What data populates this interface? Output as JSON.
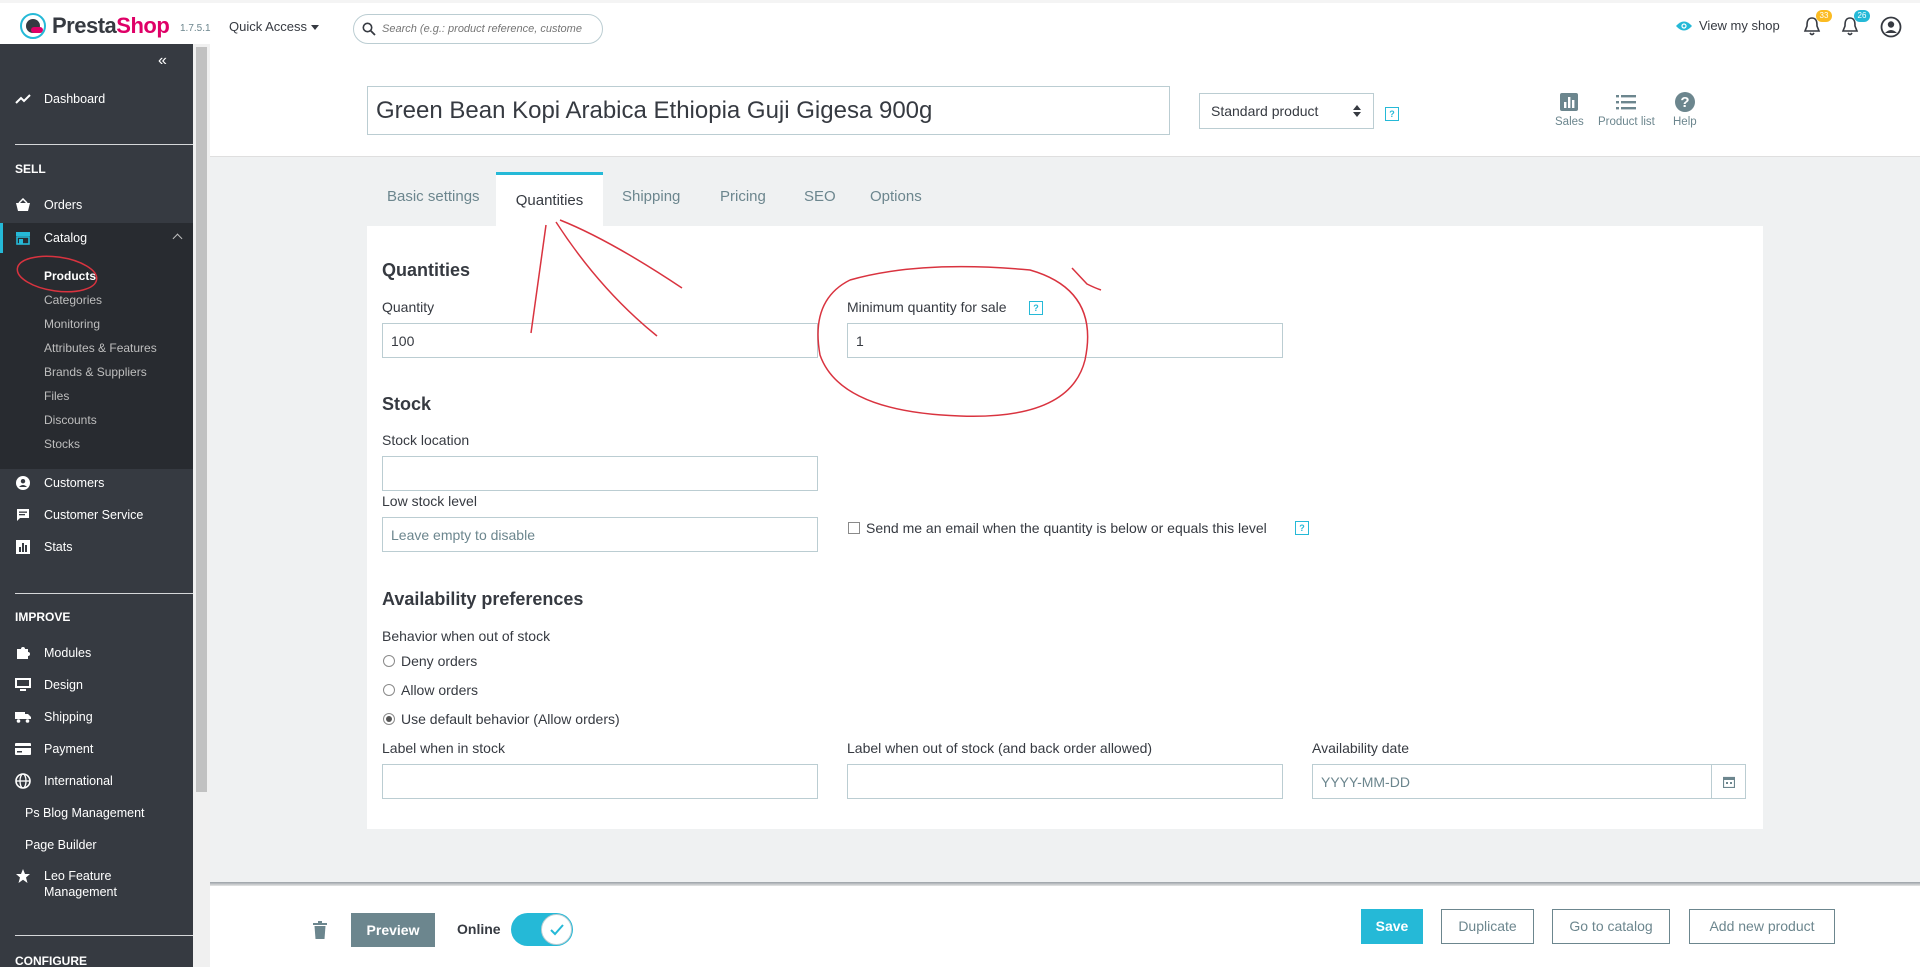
{
  "header": {
    "logo_text_presta": "Presta",
    "logo_text_shop": "Shop",
    "version": "1.7.5.1",
    "quick_access": "Quick Access",
    "search_placeholder": "Search (e.g.: product reference, custome",
    "view_shop": "View my shop",
    "notif_orders_count": "33",
    "notif_customers_count": "26"
  },
  "sidebar": {
    "dashboard": "Dashboard",
    "sell": "SELL",
    "orders": "Orders",
    "catalog": "Catalog",
    "catalog_sub": [
      "Products",
      "Categories",
      "Monitoring",
      "Attributes & Features",
      "Brands & Suppliers",
      "Files",
      "Discounts",
      "Stocks"
    ],
    "customers": "Customers",
    "customer_service": "Customer Service",
    "stats": "Stats",
    "improve": "IMPROVE",
    "modules": "Modules",
    "design": "Design",
    "shipping": "Shipping",
    "payment": "Payment",
    "international": "International",
    "ps_blog": "Ps Blog Management",
    "page_builder": "Page Builder",
    "leo_line1": "Leo Feature",
    "leo_line2": "Management",
    "configure": "CONFIGURE"
  },
  "product": {
    "name": "Green Bean Kopi Arabica Ethiopia Guji Gigesa 900g",
    "type": "Standard product"
  },
  "toolbar": {
    "sales": "Sales",
    "product_list": "Product list",
    "help": "Help"
  },
  "tabs": [
    "Basic settings",
    "Quantities",
    "Shipping",
    "Pricing",
    "SEO",
    "Options"
  ],
  "quantities": {
    "title": "Quantities",
    "quantity_label": "Quantity",
    "quantity_value": "100",
    "min_qty_label": "Minimum quantity for sale",
    "min_qty_value": "1"
  },
  "stock": {
    "title": "Stock",
    "location_label": "Stock location",
    "location_value": "",
    "low_level_label": "Low stock level",
    "low_level_placeholder": "Leave empty to disable",
    "email_checkbox": "Send me an email when the quantity is below or equals this level"
  },
  "availability": {
    "title": "Availability preferences",
    "behavior_label": "Behavior when out of stock",
    "options": [
      "Deny orders",
      "Allow orders",
      "Use default behavior (Allow orders)"
    ],
    "selected_index": 2,
    "in_stock_label": "Label when in stock",
    "out_stock_label": "Label when out of stock (and back order allowed)",
    "date_label": "Availability date",
    "date_placeholder": "YYYY-MM-DD"
  },
  "footer": {
    "preview": "Preview",
    "online": "Online",
    "save": "Save",
    "duplicate": "Duplicate",
    "go_to_catalog": "Go to catalog",
    "add_new_product": "Add new product"
  },
  "help_glyph": "?",
  "colors": {
    "accent": "#25b9d7",
    "brand_pink": "#df0067",
    "sidebar_bg": "#363a41",
    "annotation": "#d9333f"
  }
}
